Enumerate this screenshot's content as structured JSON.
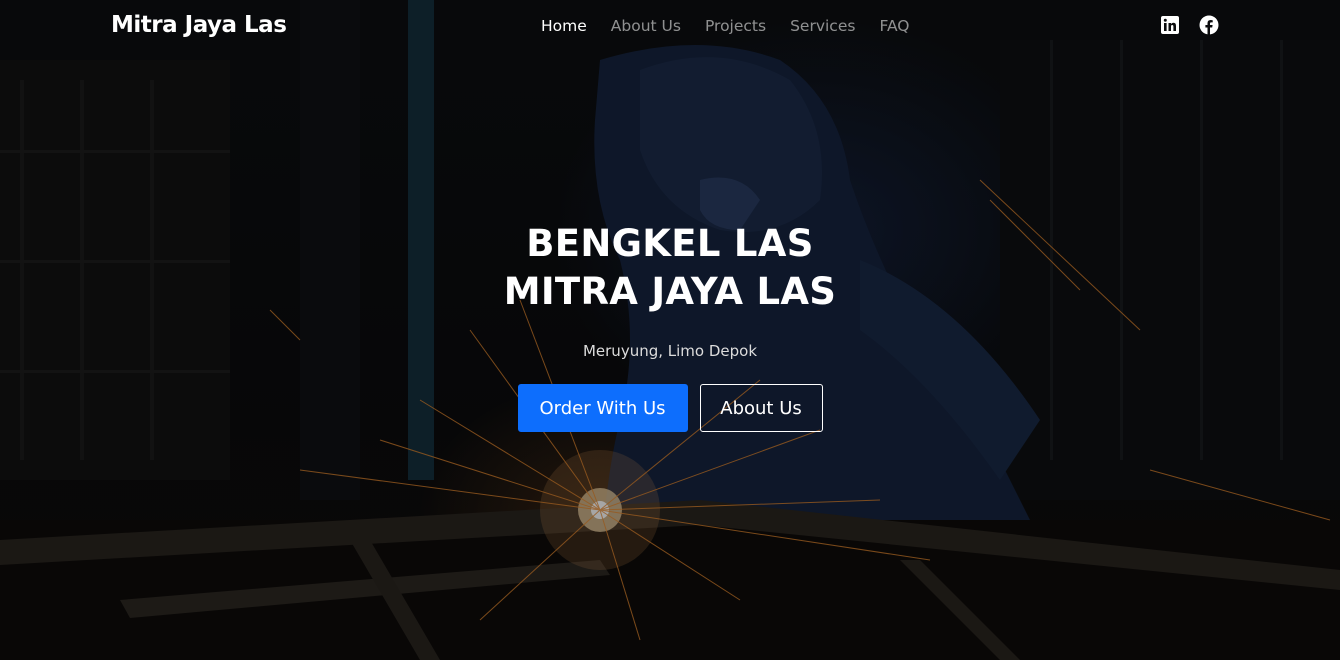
{
  "navbar": {
    "brand": "Mitra Jaya Las",
    "links": [
      {
        "label": "Home",
        "active": true
      },
      {
        "label": "About Us",
        "active": false
      },
      {
        "label": "Projects",
        "active": false
      },
      {
        "label": "Services",
        "active": false
      },
      {
        "label": "FAQ",
        "active": false
      }
    ],
    "social": [
      {
        "icon": "linkedin-icon"
      },
      {
        "icon": "facebook-icon"
      }
    ]
  },
  "hero": {
    "title_line1": "BENGKEL LAS",
    "title_line2": "MITRA JAYA LAS",
    "subtitle": "Meruyung, Limo Depok",
    "primary_button": "Order With Us",
    "secondary_button": "About Us",
    "background_image": "welder-sparks-photo"
  },
  "colors": {
    "primary": "#0d6efd",
    "text": "#ffffff",
    "nav_inactive": "rgba(255,255,255,0.55)"
  }
}
